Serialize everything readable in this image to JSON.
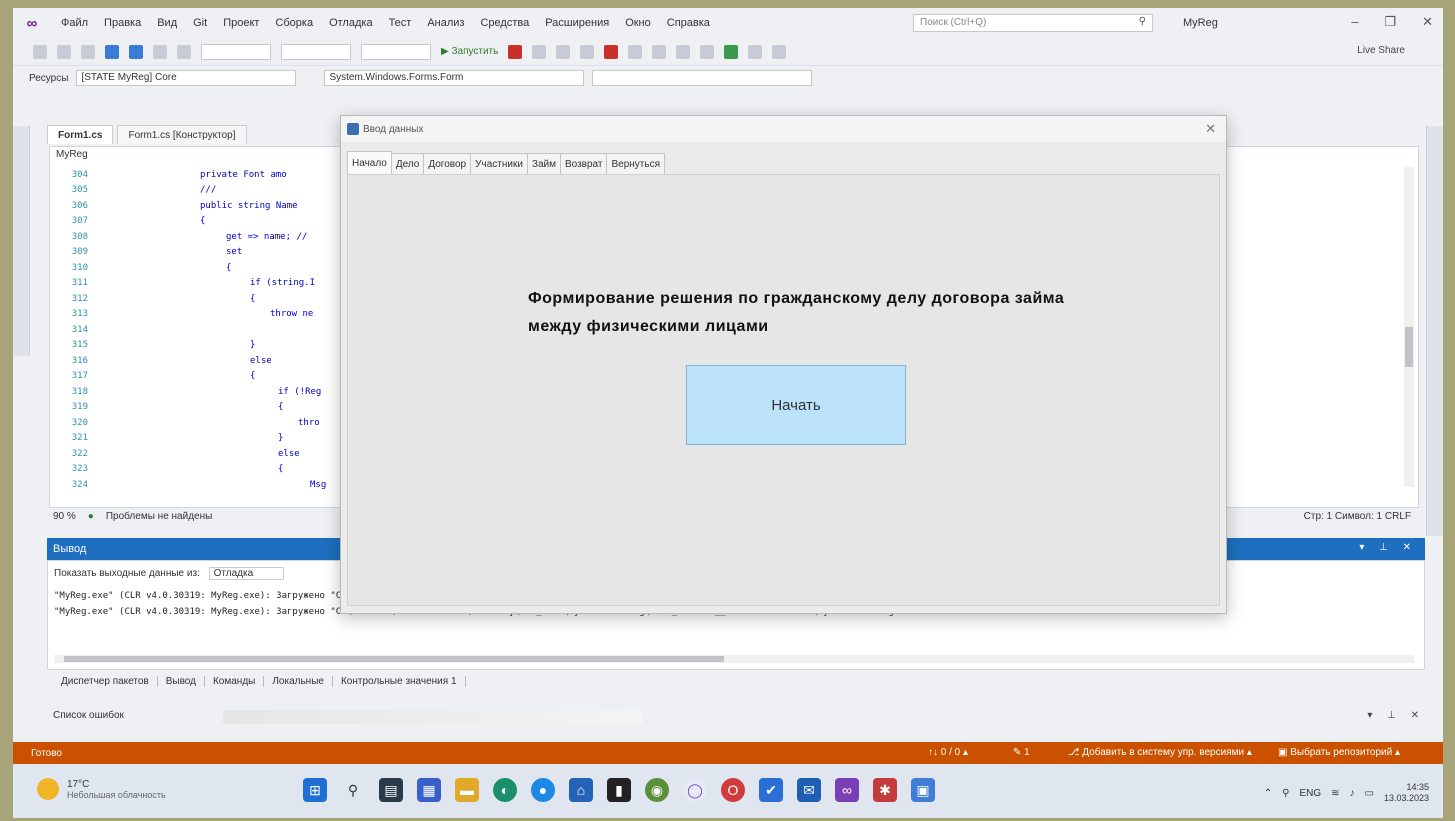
{
  "menu": {
    "items": [
      "Файл",
      "Правка",
      "Вид",
      "Git",
      "Проект",
      "Сборка",
      "Отладка",
      "Тест",
      "Анализ",
      "Средства",
      "Расширения",
      "Окно",
      "Справка"
    ],
    "search_placeholder": "Поиск (Ctrl+Q)",
    "solution_name": "MyReg"
  },
  "toolbar": {
    "start_label": "▶ Запустить",
    "live_share": "Live Share"
  },
  "navbar": {
    "label": "Ресурсы",
    "config": "[STATE MyReg] Core",
    "member": "System.Windows.Forms.Form",
    "combo3": ""
  },
  "editor": {
    "tabs": [
      "Form1.cs",
      "Form1.cs [Конструктор]"
    ],
    "project": "MyReg",
    "lines": [
      {
        "n": "304",
        "code": "private Font amo"
      },
      {
        "n": "305",
        "code": "///"
      },
      {
        "n": "306",
        "code": "public string Name"
      },
      {
        "n": "307",
        "code": "{"
      },
      {
        "n": "308",
        "code": "get => name; //"
      },
      {
        "n": "309",
        "code": "set"
      },
      {
        "n": "310",
        "code": "{"
      },
      {
        "n": "311",
        "code": "if (string.I"
      },
      {
        "n": "312",
        "code": "{"
      },
      {
        "n": "313",
        "code": "throw ne"
      },
      {
        "n": "314",
        "code": ""
      },
      {
        "n": "315",
        "code": "}"
      },
      {
        "n": "316",
        "code": "else"
      },
      {
        "n": "317",
        "code": "{"
      },
      {
        "n": "318",
        "code": "if (!Reg"
      },
      {
        "n": "319",
        "code": "{"
      },
      {
        "n": "320",
        "code": "thro"
      },
      {
        "n": "321",
        "code": "}"
      },
      {
        "n": "322",
        "code": "else"
      },
      {
        "n": "323",
        "code": "{"
      },
      {
        "n": "324",
        "code": "Msg"
      }
    ],
    "status_zoom": "90 %",
    "status_ok": "Проблемы не найдены",
    "status_right": "Стр: 1  Символ: 1  CRLF"
  },
  "output": {
    "title": "Вывод",
    "source_label": "Показать выходные данные из:",
    "source_value": "Отладка",
    "lines": [
      "\"MyReg.exe\" (CLR v4.0.30319: MyReg.exe): Загружено \"C:\\Windows\\Microsoft.Net\\assembly\\GAC_MSIL\\System.Windows.Forms\\v4.0_4.0.0.0__b77a5c561934e089\\System.Windows.Forms.dll\".",
      "\"MyReg.exe\" (CLR v4.0.30319: MyReg.exe): Загружено \"C:\\Windows\\Microsoft.Net\\assembly\\GAC_MSIL\\System.Drawing\\v4.0_4.0.0.0__b03f5f7f11d50a3a\\System.Drawing.dll\"."
    ]
  },
  "bottom_tabs": [
    "Диспетчер пакетов",
    "Вывод",
    "Команды",
    "Локальные",
    "Контрольные значения 1"
  ],
  "error_list_label": "Список ошибок",
  "vs_status": {
    "ready": "Готово",
    "items": [
      "↑↓ 0 / 0 ▴",
      "✎ 1",
      "⎇ Добавить в систему упр. версиями ▴",
      "▣ Выбрать репозиторий ▴"
    ]
  },
  "taskbar": {
    "weather_temp": "17°C",
    "weather_desc": "Небольшая облачность",
    "lang": "ENG",
    "time": "14:35",
    "date": "13.03.2023"
  },
  "dialog": {
    "title": "Ввод данных",
    "tabs": [
      "Начало",
      "Дело",
      "Договор",
      "Участники",
      "Займ",
      "Возврат",
      "Вернуться"
    ],
    "heading": "Формирование решения по гражданскому делу договора займа между физическими лицами",
    "start_button": "Начать"
  },
  "colors": {
    "vs_status_bg": "#ca5100",
    "output_header_bg": "#1e6fbf",
    "start_button_bg": "#bde3fa"
  }
}
